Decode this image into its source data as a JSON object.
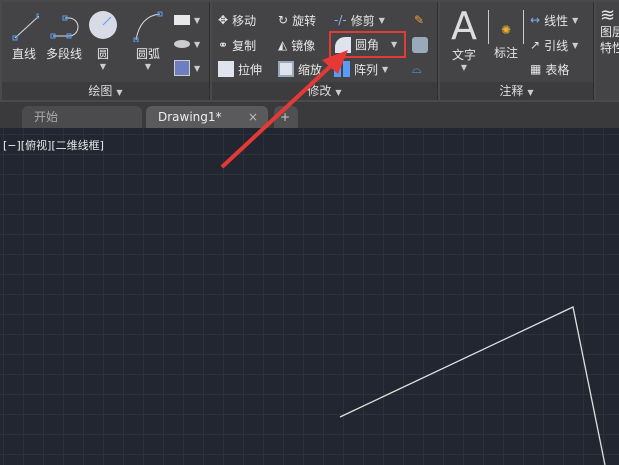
{
  "ribbon": {
    "draw_panel": {
      "label": "绘图",
      "tools": [
        "直线",
        "多段线",
        "圆",
        "圆弧"
      ]
    },
    "modify_panel": {
      "label": "修改",
      "tools": [
        "移动",
        "旋转",
        "修剪",
        "复制",
        "镜像",
        "圆角",
        "拉伸",
        "缩放",
        "阵列"
      ]
    },
    "annotate_panel": {
      "label": "注释",
      "tools": [
        "文字",
        "标注",
        "线性",
        "引线",
        "表格"
      ]
    },
    "layers_panel": {
      "tools": [
        "图层特性"
      ]
    }
  },
  "tabs": {
    "start": "开始",
    "drawing": "Drawing1*",
    "close": "×",
    "add": "+"
  },
  "viewport": {
    "label": "[−][俯视][二维线框]"
  },
  "highlight_color": "#e53935"
}
